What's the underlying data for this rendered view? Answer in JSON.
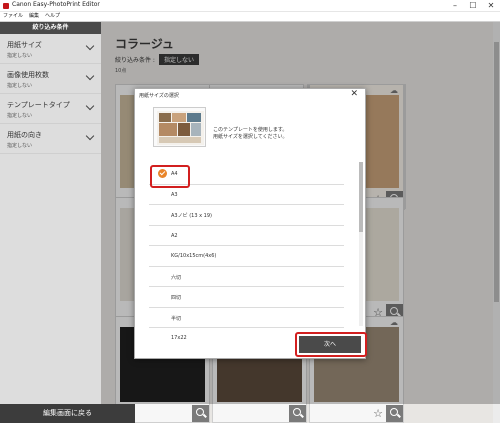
{
  "window": {
    "title": "Canon Easy-PhotoPrint Editor",
    "minimize": "–",
    "maximize": "☐",
    "close": "✕"
  },
  "menu": {
    "items": [
      "ファイル",
      "編集",
      "ヘルプ"
    ]
  },
  "sidebar": {
    "header": "絞り込み条件",
    "filters": [
      {
        "label": "用紙サイズ",
        "value": "指定しない"
      },
      {
        "label": "画像使用枚数",
        "value": "指定しない"
      },
      {
        "label": "テンプレートタイプ",
        "value": "指定しない"
      },
      {
        "label": "用紙の向き",
        "value": "指定しない"
      }
    ],
    "back_button": "編集画面に戻る"
  },
  "main": {
    "title": "コラージュ",
    "filter_label": "絞り込み条件 :",
    "filter_chip": "指定しない",
    "count": "10点"
  },
  "dialog": {
    "title": "用紙サイズの選択",
    "close": "✕",
    "message_line1": "このテンプレートを使用します。",
    "message_line2": "用紙サイズを選択してください。",
    "options": [
      "A4",
      "A3",
      "A3ノビ (13 x 19)",
      "A2",
      "KG/10x15cm(4x6)",
      "六切",
      "四切",
      "半切",
      "17x22",
      "L判"
    ],
    "selected": "A4",
    "next_button": "次へ"
  },
  "colors": {
    "accent_selected": "#e9852a",
    "highlight_frame": "#d21f1f",
    "dark_button": "#4a4a4a"
  }
}
